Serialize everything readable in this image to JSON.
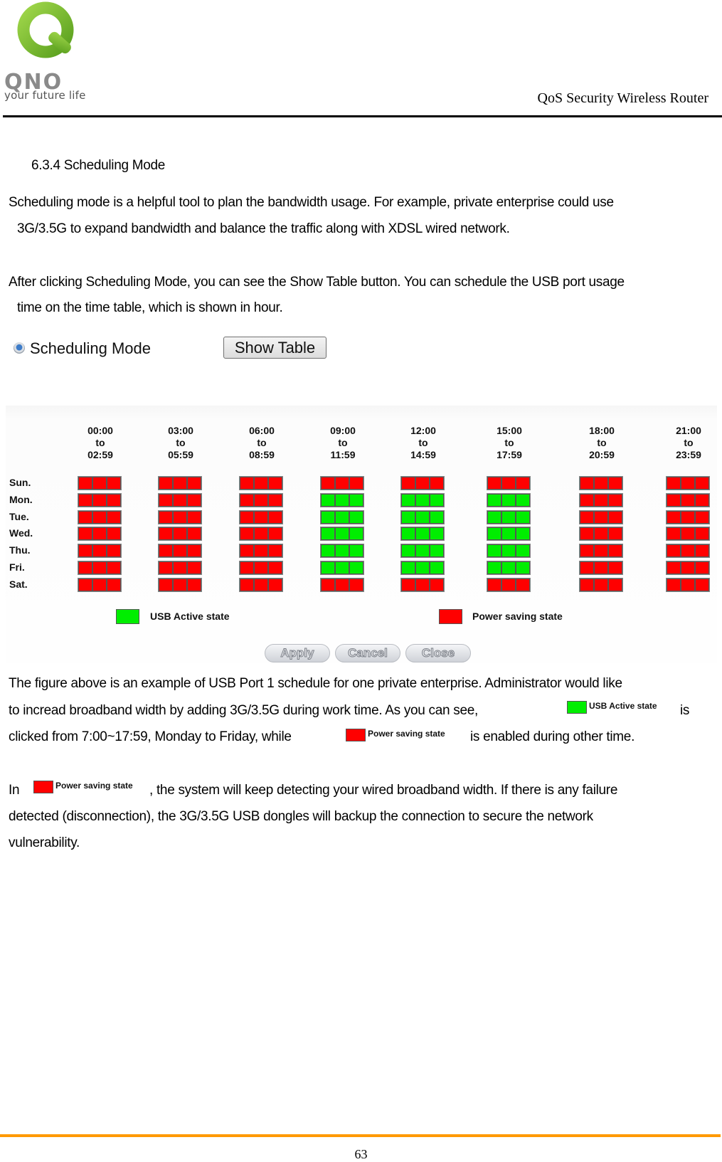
{
  "header": {
    "logo_brand": "QNO",
    "logo_tagline": "your future life",
    "title": "QoS Security Wireless Router"
  },
  "section": {
    "heading": "6.3.4 Scheduling Mode",
    "para1_line1": "Scheduling mode is a helpful tool to plan the bandwidth usage. For example, private enterprise could use",
    "para1_line2": "3G/3.5G to expand bandwidth and balance the traffic along with XDSL wired network.",
    "para2_line1": "After clicking Scheduling Mode, you can see the Show Table button.    You can schedule the USB port usage",
    "para2_line2": "time on the time table, which is shown in hour."
  },
  "controls": {
    "radio_label": "Scheduling Mode",
    "radio_checked": true,
    "show_table_label": "Show Table"
  },
  "schedule": {
    "time_blocks": [
      {
        "start": "00:00",
        "to": "to",
        "end": "02:59"
      },
      {
        "start": "03:00",
        "to": "to",
        "end": "05:59"
      },
      {
        "start": "06:00",
        "to": "to",
        "end": "08:59"
      },
      {
        "start": "09:00",
        "to": "to",
        "end": "11:59"
      },
      {
        "start": "12:00",
        "to": "to",
        "end": "14:59"
      },
      {
        "start": "15:00",
        "to": "to",
        "end": "17:59"
      },
      {
        "start": "18:00",
        "to": "to",
        "end": "20:59"
      },
      {
        "start": "21:00",
        "to": "to",
        "end": "23:59"
      }
    ],
    "days": [
      "Sun.",
      "Mon.",
      "Tue.",
      "Wed.",
      "Thu.",
      "Fri.",
      "Sat."
    ],
    "active_hours": {
      "Sun.": [],
      "Mon.": [
        9,
        10,
        11,
        12,
        13,
        14,
        15,
        16,
        17
      ],
      "Tue.": [
        9,
        10,
        11,
        12,
        13,
        14,
        15,
        16,
        17
      ],
      "Wed.": [
        9,
        10,
        11,
        12,
        13,
        14,
        15,
        16,
        17
      ],
      "Thu.": [
        9,
        10,
        11,
        12,
        13,
        14,
        15,
        16,
        17
      ],
      "Fri.": [
        9,
        10,
        11,
        12,
        13,
        14,
        15,
        16,
        17
      ],
      "Sat.": []
    },
    "colors": {
      "active": "#00ee00",
      "power_saving": "#ff0000"
    },
    "legend": {
      "active_label": "USB Active state",
      "power_saving_label": "Power saving state"
    },
    "buttons": {
      "apply": "Apply",
      "cancel": "Cancel",
      "close": "Close"
    }
  },
  "body": {
    "p3_line1": "The figure above is an example of USB Port 1 schedule for one private enterprise. Administrator would like",
    "p3_line2a": "to incread broadband width by adding 3G/3.5G during work time.    As you can see,",
    "p3_line2b": "is",
    "p3_line3a": "clicked from 7:00~17:59, Monday to Friday, while",
    "p3_line3b": "is enabled during other time.",
    "p4_line1a": "In",
    "p4_line1b": ", the system will keep detecting your wired broadband width.    If there is any failure",
    "p4_line2": "detected (disconnection), the 3G/3.5G USB dongles will backup the connection to secure the network",
    "p4_line3": "vulnerability."
  },
  "footer": {
    "page_number": "63"
  }
}
